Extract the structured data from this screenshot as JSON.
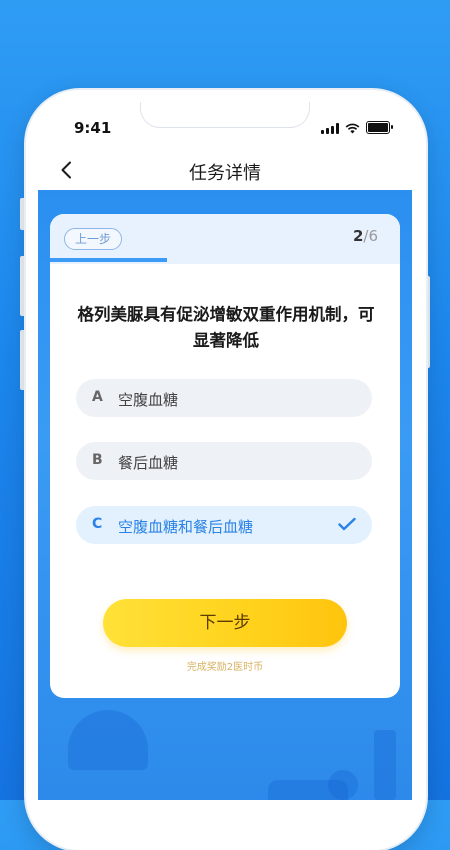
{
  "status_bar": {
    "time": "9:41"
  },
  "nav": {
    "title": "任务详情"
  },
  "quiz": {
    "prev_label": "上一步",
    "progress_current": "2",
    "progress_total": "/6",
    "progress_fraction": 0.333,
    "question": "格列美脲具有促泌增敏双重作用机制，可显著降低",
    "options": [
      {
        "letter": "A",
        "text": "空腹血糖",
        "selected": false
      },
      {
        "letter": "B",
        "text": "餐后血糖",
        "selected": false
      },
      {
        "letter": "C",
        "text": "空腹血糖和餐后血糖",
        "selected": true
      }
    ],
    "next_label": "下一步",
    "reward_text": "完成奖励2医时币"
  },
  "colors": {
    "accent": "#2a83e6",
    "button": "#ffd21c",
    "reward": "#d8b261"
  }
}
